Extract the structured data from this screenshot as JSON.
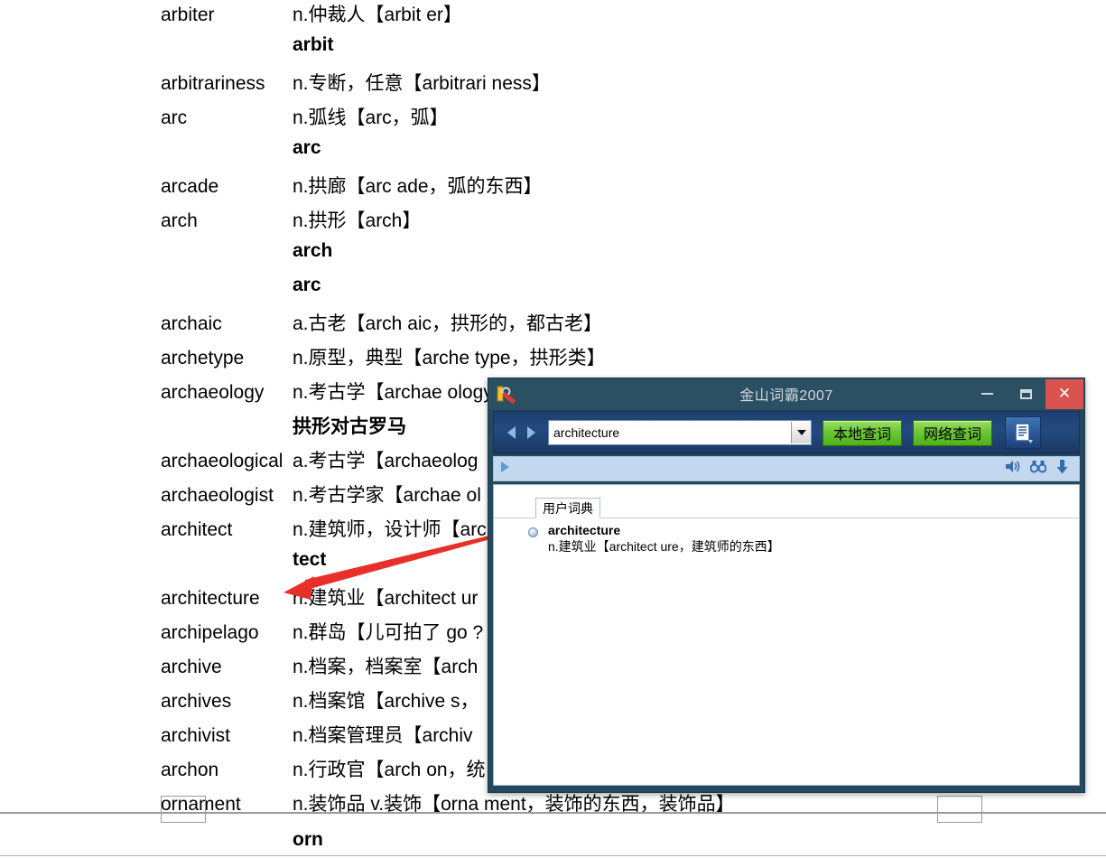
{
  "document": {
    "entries": [
      {
        "term": "arbiter",
        "definition": "n.仲裁人【arbit er】",
        "style": "normal"
      },
      {
        "term": "",
        "definition": "arbit",
        "style": "bold"
      },
      {
        "term": "arbitrariness",
        "definition": "n.专断，任意【arbitrari ness】",
        "style": "normal"
      },
      {
        "term": "arc",
        "definition": "n.弧线【arc，弧】",
        "style": "normal"
      },
      {
        "term": "",
        "definition": "arc",
        "style": "bold"
      },
      {
        "term": "arcade",
        "definition": "n.拱廊【arc ade，弧的东西】",
        "style": "normal"
      },
      {
        "term": "arch",
        "definition": "n.拱形【arch】",
        "style": "normal"
      },
      {
        "term": "",
        "definition": "arch",
        "style": "bold"
      },
      {
        "term": "",
        "definition": "arc",
        "style": "bold"
      },
      {
        "term": "archaic",
        "definition": "a.古老【arch aic，拱形的，都古老】",
        "style": "normal"
      },
      {
        "term": "archetype",
        "definition": "n.原型，典型【arche type，拱形类】",
        "style": "normal"
      },
      {
        "term": "archaeology",
        "definition": "n.考古学【archae ology，拱形学】",
        "style": "normal"
      },
      {
        "term": "",
        "definition": "拱形对古罗马",
        "style": "bold"
      },
      {
        "term": "archaeological",
        "definition": "a.考古学【archaeolog",
        "style": "normal"
      },
      {
        "term": "archaeologist",
        "definition": "n.考古学家【archae ol",
        "style": "normal"
      },
      {
        "term": "architect",
        "definition": "n.建筑师，设计师【arc",
        "style": "normal"
      },
      {
        "term": "",
        "definition": "tect",
        "style": "bold"
      },
      {
        "term": "architecture",
        "definition": "n.建筑业【architect ur",
        "style": "normal"
      },
      {
        "term": "archipelago",
        "definition": "n.群岛【儿可拍了 go ?",
        "style": "normal"
      },
      {
        "term": "archive",
        "definition": "n.档案，档案室【arch",
        "style": "normal"
      },
      {
        "term": "archives",
        "definition": "n.档案馆【archive s，",
        "style": "normal"
      },
      {
        "term": "archivist",
        "definition": "n.档案管理员【archiv",
        "style": "normal"
      },
      {
        "term": "archon",
        "definition": "n.行政官【arch on，统",
        "style": "normal"
      },
      {
        "term": "ornament",
        "definition": "n.装饰品 v.装饰【orna ment，装饰的东西，装饰品】",
        "style": "normal"
      }
    ],
    "footer_word": "orn"
  },
  "annotation": {
    "arrow_color": "#e8302a",
    "points_to": "architecture"
  },
  "dict_window": {
    "title": "金山词霸2007",
    "app_icon": "dictionary-magnifier-icon",
    "window_controls": {
      "minimize": "−",
      "maximize": "▢",
      "close": "✕",
      "close_color": "#d9534f"
    },
    "toolbar": {
      "back_icon": "arrow-left-icon",
      "forward_icon": "arrow-right-icon",
      "search_value": "architecture",
      "search_placeholder": "",
      "dropdown_icon": "chevron-down-icon",
      "local_lookup_label": "本地查词",
      "network_lookup_label": "网络查词",
      "doc_icon": "document-icon"
    },
    "subbar": {
      "expand_icon": "triangle-right-icon",
      "speaker_icon": "speaker-icon",
      "binoculars_icon": "binoculars-icon",
      "download_icon": "arrow-down-icon"
    },
    "content": {
      "tab_label": "用户词典",
      "entry_word": "architecture",
      "entry_definition": "n.建筑业【architect ure，建筑师的东西】"
    }
  }
}
